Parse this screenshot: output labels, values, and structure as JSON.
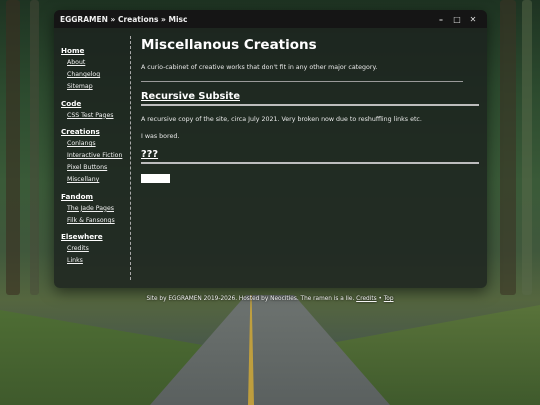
{
  "window": {
    "title": "EGGRAMEN » Creations » Misc",
    "controls": [
      "–",
      "□",
      "✕"
    ]
  },
  "sidebar": {
    "sections": [
      {
        "heading": "Home",
        "links": [
          "About",
          "Changelog",
          "Sitemap"
        ]
      },
      {
        "heading": "Code",
        "links": [
          "CSS Test Pages"
        ]
      },
      {
        "heading": "Creations",
        "links": [
          "Conlangs",
          "Interactive Fiction",
          "Pixel Buttons",
          "Miscellany"
        ]
      },
      {
        "heading": "Fandom",
        "links": [
          "The Jade Pages",
          "Filk & Fansongs"
        ]
      },
      {
        "heading": "Elsewhere",
        "links": [
          "Credits",
          "Links"
        ]
      }
    ]
  },
  "main": {
    "title": "Miscellanous Creations",
    "intro": "A curio-cabinet of creative works that don't fit in any other major category.",
    "sections": [
      {
        "heading": "Recursive Subsite",
        "paragraphs": [
          "A recursive copy of the site, circa July 2021. Very broken now due to reshuffling links etc.",
          "I was bored."
        ]
      },
      {
        "heading": "???",
        "paragraphs": []
      }
    ]
  },
  "footer": {
    "text": "Site by EGGRAMEN 2019-2026. Hosted by Neocities. The ramen is a lie.",
    "credits_label": "Credits",
    "separator": "•",
    "top_label": "Top"
  }
}
